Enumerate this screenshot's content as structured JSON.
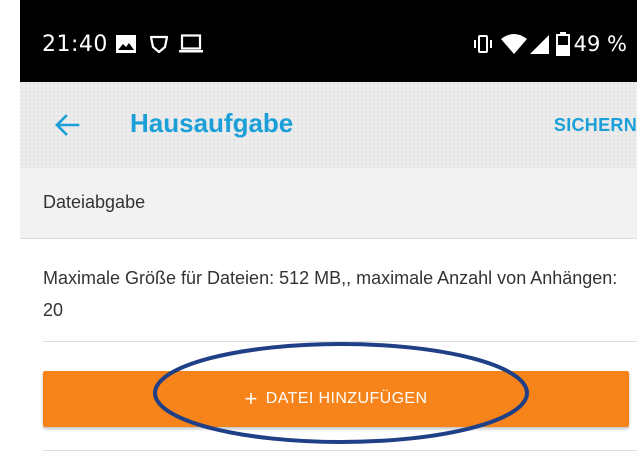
{
  "status_bar": {
    "time": "21:40",
    "battery": "49 %",
    "icons": [
      "image-icon",
      "shield-icon",
      "laptop-icon",
      "vibrate-icon",
      "wifi-icon",
      "signal-icon",
      "battery-icon"
    ]
  },
  "app_bar": {
    "title": "Hausaufgabe",
    "save_label": "SICHERN",
    "back_icon": "back-arrow-icon",
    "accent_color": "#1a9fd9"
  },
  "section": {
    "header": "Dateiabgabe",
    "info": "Maximale Größe für Dateien: 512 MB,, maximale Anzahl von Anhängen: 20"
  },
  "add_file_button": {
    "icon": "+",
    "label": "DATEI HINZUFÜGEN",
    "color": "#f7841a"
  },
  "annotation": {
    "shape": "ellipse",
    "color": "#1f3f86"
  }
}
